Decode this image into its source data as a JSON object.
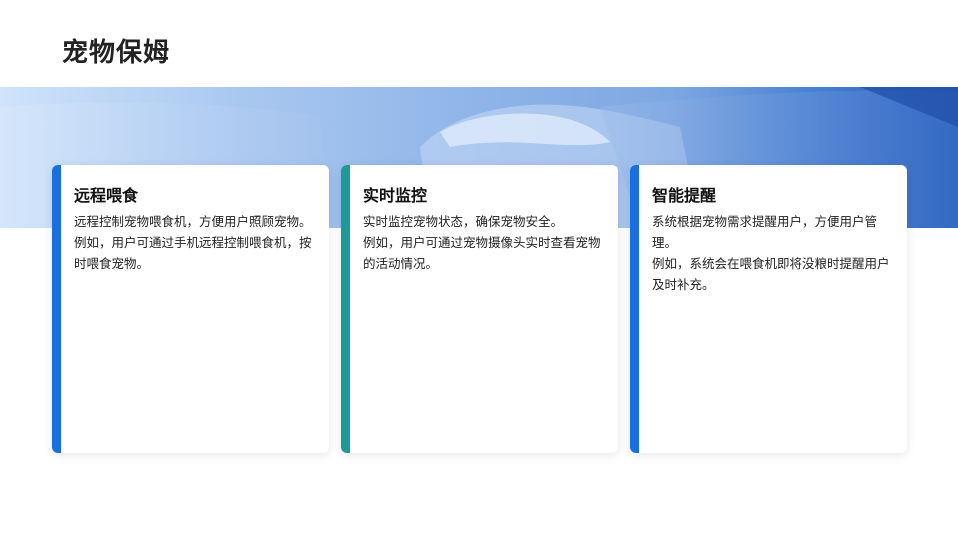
{
  "page": {
    "title": "宠物保姆"
  },
  "colors": {
    "accent_blue": "#1a6fe0",
    "accent_teal": "#1c9a9a"
  },
  "cards": [
    {
      "title": "远程喂食",
      "lines": [
        "远程控制宠物喂食机，方便用户照顾宠物。",
        "例如，用户可通过手机远程控制喂食机，按时喂食宠物。"
      ]
    },
    {
      "title": "实时监控",
      "lines": [
        "实时监控宠物状态，确保宠物安全。",
        "例如，用户可通过宠物摄像头实时查看宠物的活动情况。"
      ]
    },
    {
      "title": "智能提醒",
      "lines": [
        "系统根据宠物需求提醒用户，方便用户管理。",
        "例如，系统会在喂食机即将没粮时提醒用户及时补充。"
      ]
    }
  ]
}
